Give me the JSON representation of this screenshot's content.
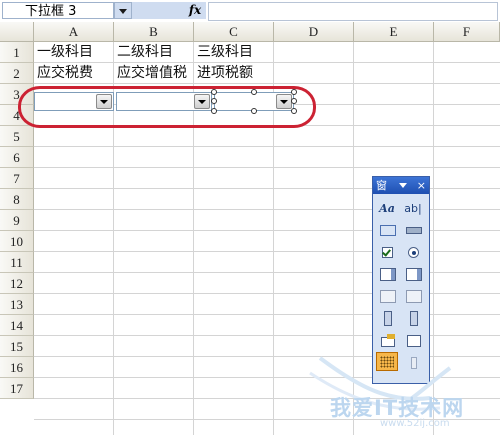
{
  "formula_bar": {
    "name_box": "下拉框 3",
    "fx_label": "fx",
    "formula": ""
  },
  "columns": [
    "A",
    "B",
    "C",
    "D",
    "E",
    "F"
  ],
  "rows": [
    "1",
    "2",
    "3",
    "4",
    "5",
    "6",
    "7",
    "8",
    "9",
    "10",
    "11",
    "12",
    "13",
    "14",
    "15",
    "16",
    "17"
  ],
  "cells": {
    "A1": "一级科目",
    "B1": "二级科目",
    "C1": "三级科目",
    "A2": "应交税费",
    "B2": "应交增值税",
    "C2": "进项税额"
  },
  "forms_toolbar": {
    "title": "窗",
    "close": "×",
    "label_tool": "Aa",
    "edit_tool": "ab|"
  },
  "watermark": {
    "text": "我爱IT技术网",
    "sub": "www.52ij.com"
  },
  "colors": {
    "annotation": "#cc2233",
    "toolbar_title": "#1e4fb1",
    "selected_tool": "#f6b64a"
  }
}
